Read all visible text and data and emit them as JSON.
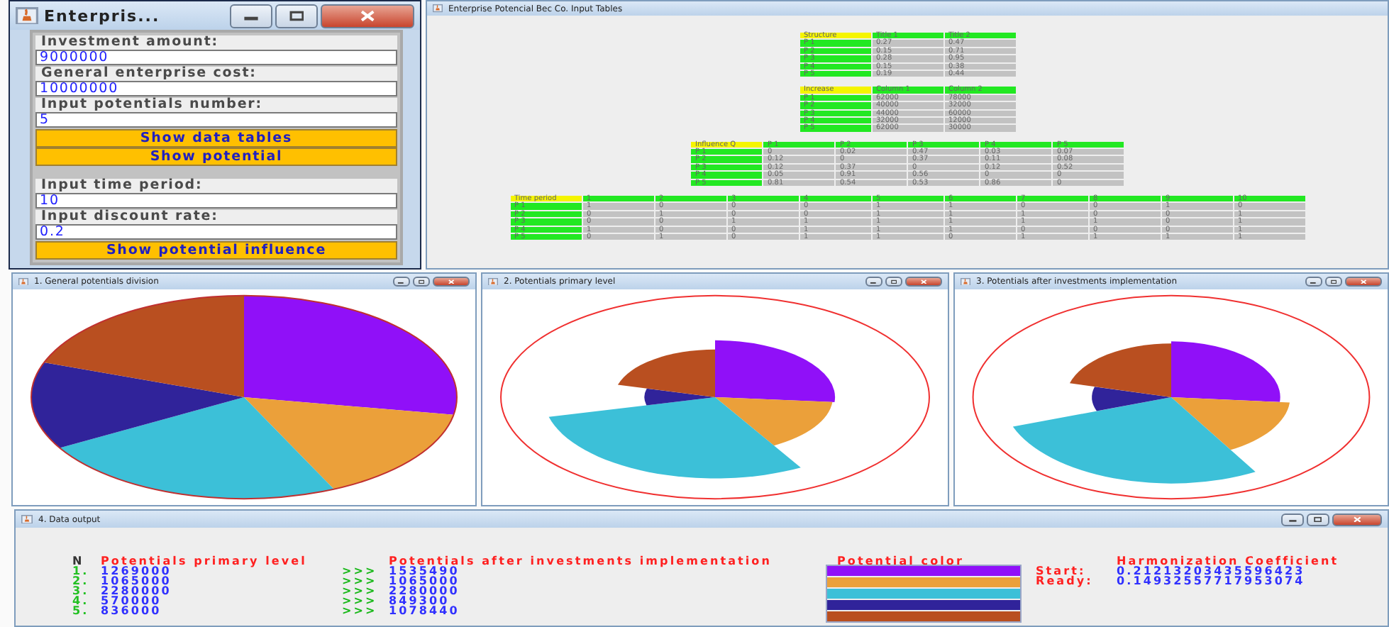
{
  "input_window": {
    "title": "Enterpris...",
    "items": [
      {
        "kind": "field",
        "label": "Investment amount:",
        "value": "9000000"
      },
      {
        "kind": "field",
        "label": "General enterprise cost:",
        "value": "10000000"
      },
      {
        "kind": "field",
        "label": "Input potentials number:",
        "value": "5"
      },
      {
        "kind": "button",
        "label": "Show data tables"
      },
      {
        "kind": "button",
        "label": "Show potential"
      },
      {
        "kind": "spacer"
      },
      {
        "kind": "field",
        "label": "Input time period:",
        "value": "10"
      },
      {
        "kind": "field",
        "label": "Input discount rate:",
        "value": "0.2"
      },
      {
        "kind": "button",
        "label": "Show potential influence"
      }
    ]
  },
  "tables_window": {
    "title": "Enterprise Potencial Bec Co. Input Tables",
    "tables": [
      {
        "columns": [
          "Structure",
          "Title 1",
          "Title 2"
        ],
        "rows": [
          [
            "P 1",
            "0.27",
            "0.47"
          ],
          [
            "P 2",
            "0.15",
            "0.71"
          ],
          [
            "P 3",
            "0.28",
            "0.95"
          ],
          [
            "P 4",
            "0.15",
            "0.38"
          ],
          [
            "P 5",
            "0.19",
            "0.44"
          ]
        ]
      },
      {
        "columns": [
          "Increase",
          "Column 1",
          "Column 2"
        ],
        "rows": [
          [
            "P 1",
            "62000",
            "78000"
          ],
          [
            "P 2",
            "40000",
            "32000"
          ],
          [
            "P 3",
            "44000",
            "60000"
          ],
          [
            "P 4",
            "32000",
            "12000"
          ],
          [
            "P 5",
            "62000",
            "30000"
          ]
        ]
      },
      {
        "columns": [
          "Influence Q",
          "P 1",
          "P 2",
          "P 3",
          "P 4",
          "P 5"
        ],
        "rows": [
          [
            "P 1",
            "0",
            "0.02",
            "0.47",
            "0.03",
            "0.07"
          ],
          [
            "P 2",
            "0.12",
            "0",
            "0.37",
            "0.11",
            "0.08"
          ],
          [
            "P 3",
            "0.12",
            "0.37",
            "0",
            "0.12",
            "0.52"
          ],
          [
            "P 4",
            "0.05",
            "0.91",
            "0.56",
            "0",
            "0"
          ],
          [
            "P 5",
            "0.81",
            "0.54",
            "0.53",
            "0.86",
            "0"
          ]
        ]
      },
      {
        "columns": [
          "Time period",
          "1",
          "2",
          "3",
          "4",
          "5",
          "6",
          "7",
          "8",
          "9",
          "10"
        ],
        "rows": [
          [
            "P 1",
            "1",
            "0",
            "0",
            "0",
            "1",
            "1",
            "0",
            "0",
            "1",
            "0"
          ],
          [
            "P 2",
            "0",
            "1",
            "0",
            "0",
            "1",
            "1",
            "1",
            "0",
            "0",
            "1"
          ],
          [
            "P 3",
            "0",
            "0",
            "1",
            "1",
            "1",
            "1",
            "1",
            "1",
            "0",
            "1"
          ],
          [
            "P 4",
            "1",
            "0",
            "0",
            "1",
            "1",
            "1",
            "0",
            "0",
            "0",
            "1"
          ],
          [
            "P 5",
            "0",
            "1",
            "0",
            "1",
            "1",
            "0",
            "1",
            "1",
            "1",
            "1"
          ]
        ]
      }
    ]
  },
  "chart_windows": [
    {
      "title": "1. General potentials division",
      "kind": "pie"
    },
    {
      "title": "2. Potentials primary level",
      "kind": "rose"
    },
    {
      "title": "3. Potentials after investments implementation",
      "kind": "rose"
    }
  ],
  "output_window": {
    "title": "4. Data output",
    "headers": {
      "n": "N",
      "primary": "Potentials primary level",
      "after": "Potentials after investments implementation",
      "legend": "Potential color",
      "coefficient": "Harmonization Coefficient"
    },
    "rows": [
      {
        "n": "1.",
        "primary": "1269000",
        "arrow": ">>>",
        "after": "1535490"
      },
      {
        "n": "2.",
        "primary": "1065000",
        "arrow": ">>>",
        "after": "1065000"
      },
      {
        "n": "3.",
        "primary": "2280000",
        "arrow": ">>>",
        "after": "2280000"
      },
      {
        "n": "4.",
        "primary": "570000",
        "arrow": ">>>",
        "after": "849300"
      },
      {
        "n": "5.",
        "primary": "836000",
        "arrow": ">>>",
        "after": "1078440"
      }
    ],
    "colors": [
      {
        "color": "#9010f8"
      },
      {
        "color": "#eba03a"
      },
      {
        "color": "#3cc0d8"
      },
      {
        "color": "#30239a"
      },
      {
        "color": "#b94f20"
      }
    ],
    "coefficients": [
      {
        "label": "Start:",
        "value": "0.21213203435596423"
      },
      {
        "label": "Ready:",
        "value": "0.14932557717953074"
      }
    ]
  }
}
